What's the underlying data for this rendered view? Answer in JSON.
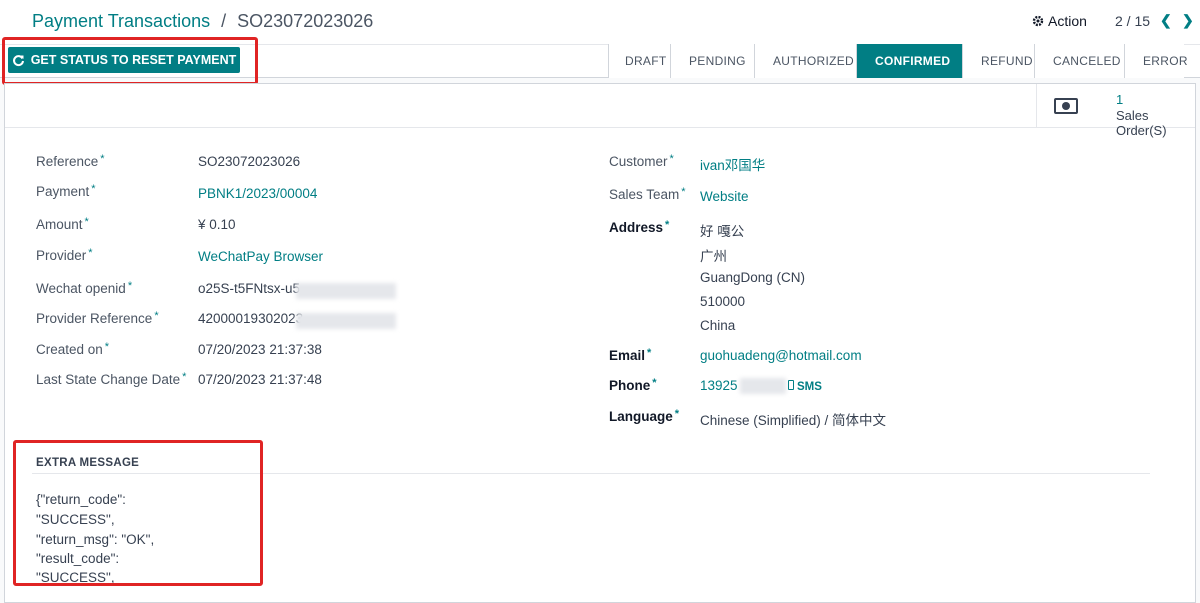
{
  "breadcrumb": {
    "parent": "Payment Transactions",
    "separator": "/",
    "current": "SO23072023026"
  },
  "toolbar": {
    "action_label": "Action",
    "pager": "2 / 15",
    "prev_icon": "chevron-left-icon",
    "next_icon": "chevron-right-icon"
  },
  "reset_button": {
    "label": "GET STATUS TO RESET PAYMENT",
    "icon": "refresh-icon"
  },
  "stages": [
    "DRAFT",
    "PENDING",
    "AUTHORIZED",
    "CONFIRMED",
    "REFUND",
    "CANCELED",
    "ERROR"
  ],
  "active_stage": "CONFIRMED",
  "smart_button": {
    "count": "1",
    "label": "Sales Order(S)",
    "icon": "money-icon"
  },
  "left_fields": [
    {
      "label": "Reference",
      "value": "SO23072023026"
    },
    {
      "label": "Payment",
      "value": "PBNK1/2023/00004"
    },
    {
      "label": "Amount",
      "value": "¥ 0.10"
    },
    {
      "label": "Provider",
      "value": "WeChatPay Browser"
    },
    {
      "label": "Wechat openid",
      "value": "o25S-t5FNtsx-u5"
    },
    {
      "label": "Provider Reference",
      "value": "42000019302023"
    },
    {
      "label": "Created on",
      "value": "07/20/2023 21:37:38"
    },
    {
      "label": "Last State Change Date",
      "value": "07/20/2023 21:37:48"
    }
  ],
  "customer": {
    "label": "Customer",
    "value": "ivan邓国华"
  },
  "sales_team": {
    "label": "Sales Team",
    "value": "Website"
  },
  "address": {
    "label": "Address",
    "lines": [
      "好 嘎公",
      "广州",
      "GuangDong (CN)",
      "510000",
      "China"
    ]
  },
  "email": {
    "label": "Email",
    "value": "guohuadeng@hotmail.com"
  },
  "phone": {
    "label": "Phone",
    "value": "13925",
    "sms": "SMS"
  },
  "language": {
    "label": "Language",
    "value": "Chinese (Simplified) / 简体中文"
  },
  "extra_message": {
    "title": "EXTRA MESSAGE",
    "lines": [
      "{\"return_code\":",
      "\"SUCCESS\",",
      "\"return_msg\": \"OK\",",
      "\"result_code\":",
      "\"SUCCESS\","
    ]
  },
  "colors": {
    "accent": "#017e84",
    "highlight": "#e02424"
  }
}
